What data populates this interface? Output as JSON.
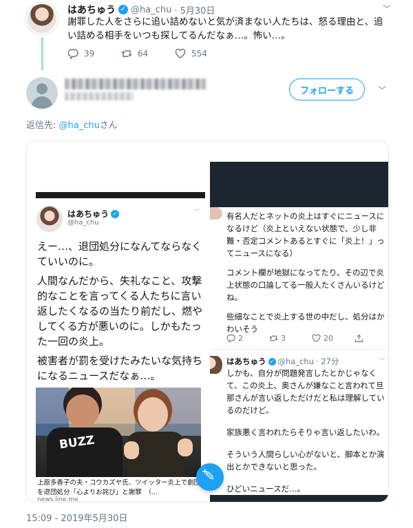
{
  "parent_tweet": {
    "name": "はあちゅう",
    "handle": "@ha_chu",
    "date": "· 5月30日",
    "text": "謝罪した人をさらに追い詰めないと気が済まない人たちは、怒る理由と、追い詰める相手をいつも探してるんだなぁ…。怖い…。",
    "replies": "39",
    "retweets": "64",
    "likes": "554"
  },
  "reply_tweet": {
    "follow_label": "フォローする",
    "reply_to_label": "返信先:",
    "reply_to_handle": "@ha_chu",
    "reply_to_suffix": "さん",
    "timestamp": "15:09 - 2019年5月30日"
  },
  "left_screenshot": {
    "name": "はあちゅう",
    "handle": "@ha_chu",
    "paragraphs": [
      "えー…、退団処分になんてならなくていいのに。",
      "人間なんだから、失礼なこと、攻撃的なことを言ってくる人たちに言い返したくなるの当たり前だし、燃やしてくる方が悪いのに。しかもたった一回の炎上。",
      "被害者が罰を受けたみたいな気持ちになるニュースだなぁ…。"
    ],
    "news_image_text": "BUZZ",
    "news_caption": "上原多香子の夫・コウカズヤ氏、ツイッター炎上で劇団を退団処分「心よりお詫び」と謝罪　（...",
    "news_source": "news.line.me"
  },
  "right_screenshot": {
    "paragraphs": [
      "有名人だとネットの炎上はすぐにニュースになるけど（炎上といえない状態で、少し非難・否定コメントあるとすぐに「炎上！」ってニュースになる）",
      "コメント欄が地獄になってたり、その辺で炎上状態の口論してる一般人たくさんいるけどね。",
      "些細なことで炎上する世の中だし、処分はかわいそう"
    ],
    "replies": "2",
    "retweets": "3",
    "likes": "20",
    "second_tweet": {
      "name": "はあちゅう",
      "handle": "@ha_chu",
      "time": "· 27分",
      "paragraphs": [
        "しかも、自分が問題発言したとかじゃなくて、この炎上、奥さんが嫌なこと言われて旦那さんが言い返しただけだと私は理解しているのだけど。",
        "家族悪く言われたらそりゃ言い返したいわ。",
        "そういう人間らしい心がないと、脚本とか演出とかできないと思った。",
        "ひどいニュースだ…。"
      ]
    }
  },
  "colors": {
    "accent": "#1da1f2",
    "thread_line": "#9fe5c2",
    "muted": "#657786"
  }
}
